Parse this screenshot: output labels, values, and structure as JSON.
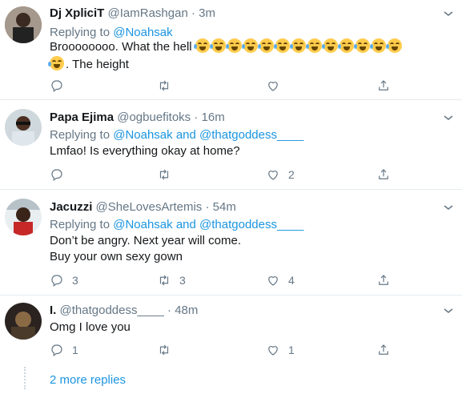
{
  "tweets": [
    {
      "name": "Dj XpliciT",
      "handle": "@IamRashgan",
      "time": "3m",
      "replying_prefix": "Replying to ",
      "replying_to": "@Noahsak",
      "body_line1": "Broooooooo. What the hell",
      "emoji_count": 14,
      "body_line2": ". The height",
      "reply_count": "",
      "retweet_count": "",
      "like_count": ""
    },
    {
      "name": "Papa Ejima",
      "handle": "@ogbuefitoks",
      "time": "16m",
      "replying_prefix": "Replying to ",
      "replying_to": "@Noahsak and @thatgoddess____",
      "body_line1": "Lmfao! Is everything okay at home?",
      "reply_count": "",
      "retweet_count": "",
      "like_count": "2"
    },
    {
      "name": "Jacuzzi",
      "handle": "@SheLovesArtemis",
      "time": "54m",
      "replying_prefix": "Replying to ",
      "replying_to": "@Noahsak and @thatgoddess____",
      "body_line1": "Don’t be angry. Next year will come.",
      "body_line2": "Buy your own sexy gown",
      "reply_count": "3",
      "retweet_count": "3",
      "like_count": "4"
    },
    {
      "name": "I.",
      "handle": "@thatgoddess____",
      "time": "48m",
      "body_line1": "Omg I love you",
      "reply_count": "1",
      "retweet_count": "",
      "like_count": "1"
    }
  ],
  "separator": " · ",
  "more_replies": "2 more replies",
  "icons": [
    "reply-icon",
    "retweet-icon",
    "like-icon",
    "share-icon",
    "chevron-down-icon"
  ],
  "colors": {
    "link": "#1b95e0",
    "meta": "#657786",
    "text": "#14171a",
    "divider": "#e6ecf0"
  }
}
